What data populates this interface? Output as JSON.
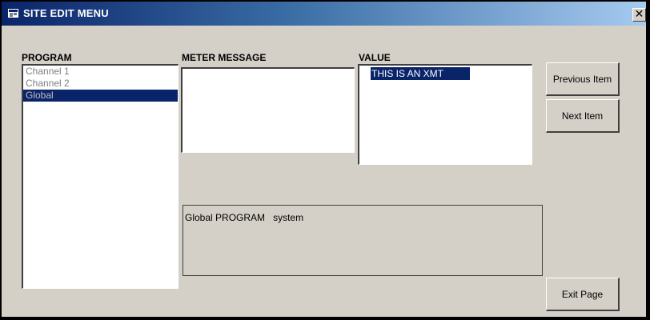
{
  "window": {
    "title": "SITE EDIT MENU",
    "close_glyph": "✕",
    "title_icon": "app-icon"
  },
  "program": {
    "label": "PROGRAM",
    "items": [
      {
        "label": "Channel 1",
        "selected": false
      },
      {
        "label": "Channel 2",
        "selected": false
      },
      {
        "label": "Global",
        "selected": true
      }
    ]
  },
  "meter_message": {
    "label": "METER MESSAGE",
    "text": ""
  },
  "value": {
    "label": "VALUE",
    "items": [
      {
        "label": "THIS IS AN XMT",
        "selected": true
      }
    ]
  },
  "info": {
    "program_name": "Global",
    "program_word": "PROGRAM",
    "program_item": "system"
  },
  "buttons": {
    "previous": "Previous Item",
    "next": "Next Item",
    "exit": "Exit Page"
  },
  "colors": {
    "title_start": "#0a246a",
    "title_end": "#a6caf0",
    "face": "#d4d0c8",
    "selection": "#0a246a"
  }
}
